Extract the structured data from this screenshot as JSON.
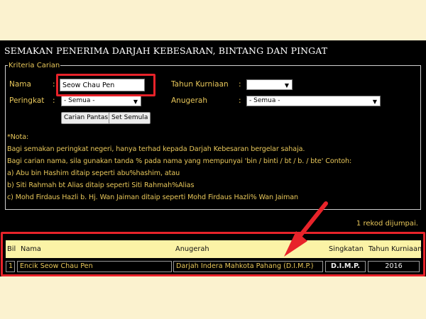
{
  "title": "SEMAKAN PENERIMA DARJAH KEBESARAN, BINTANG DAN PINGAT",
  "criteria": {
    "legend": "Kriteria Carian",
    "nama_label": "Nama",
    "nama_value": "Seow Chau Pen",
    "peringkat_label": "Peringkat",
    "peringkat_value": "- Semua -",
    "tahun_label": "Tahun Kurniaan",
    "tahun_value": "",
    "anugerah_label": "Anugerah",
    "anugerah_value": "- Semua -",
    "colon": ":",
    "search_button": "Carian Pantas",
    "reset_button": "Set Semula"
  },
  "notes": [
    "*Nota:",
    "Bagi semakan peringkat negeri, hanya terhad kepada Darjah Kebesaran bergelar sahaja.",
    "Bagi carian nama, sila gunakan tanda % pada nama yang mempunyai 'bin / binti / bt / b. / bte' Contoh:",
    "a) Abu bin Hashim ditaip seperti abu%hashim, atau",
    "b) Siti Rahmah bt Alias ditaip seperti Siti Rahmah%Alias",
    "c) Mohd Firdaus Hazli b. Hj. Wan Jaiman ditaip seperti Mohd Firdaus Hazli% Wan Jaiman"
  ],
  "results": {
    "count_text": "1 rekod dijumpai.",
    "headers": [
      "Bil",
      "Nama",
      "Anugerah",
      "Singkatan",
      "Tahun Kurniaan"
    ],
    "rows": [
      [
        "1",
        "Encik Seow Chau Pen",
        "Darjah Indera Mahkota Pahang (D.I.M.P.)",
        "D.I.M.P.",
        "2016"
      ]
    ]
  },
  "colors": {
    "accent_text": "#e8c75a",
    "highlight": "#e8232a",
    "header_bg": "#fbf3a6",
    "page_bg": "#fbf2cf"
  },
  "icons": {
    "dropdown": "chevron-down-icon",
    "annotation": "red-arrow-icon"
  }
}
